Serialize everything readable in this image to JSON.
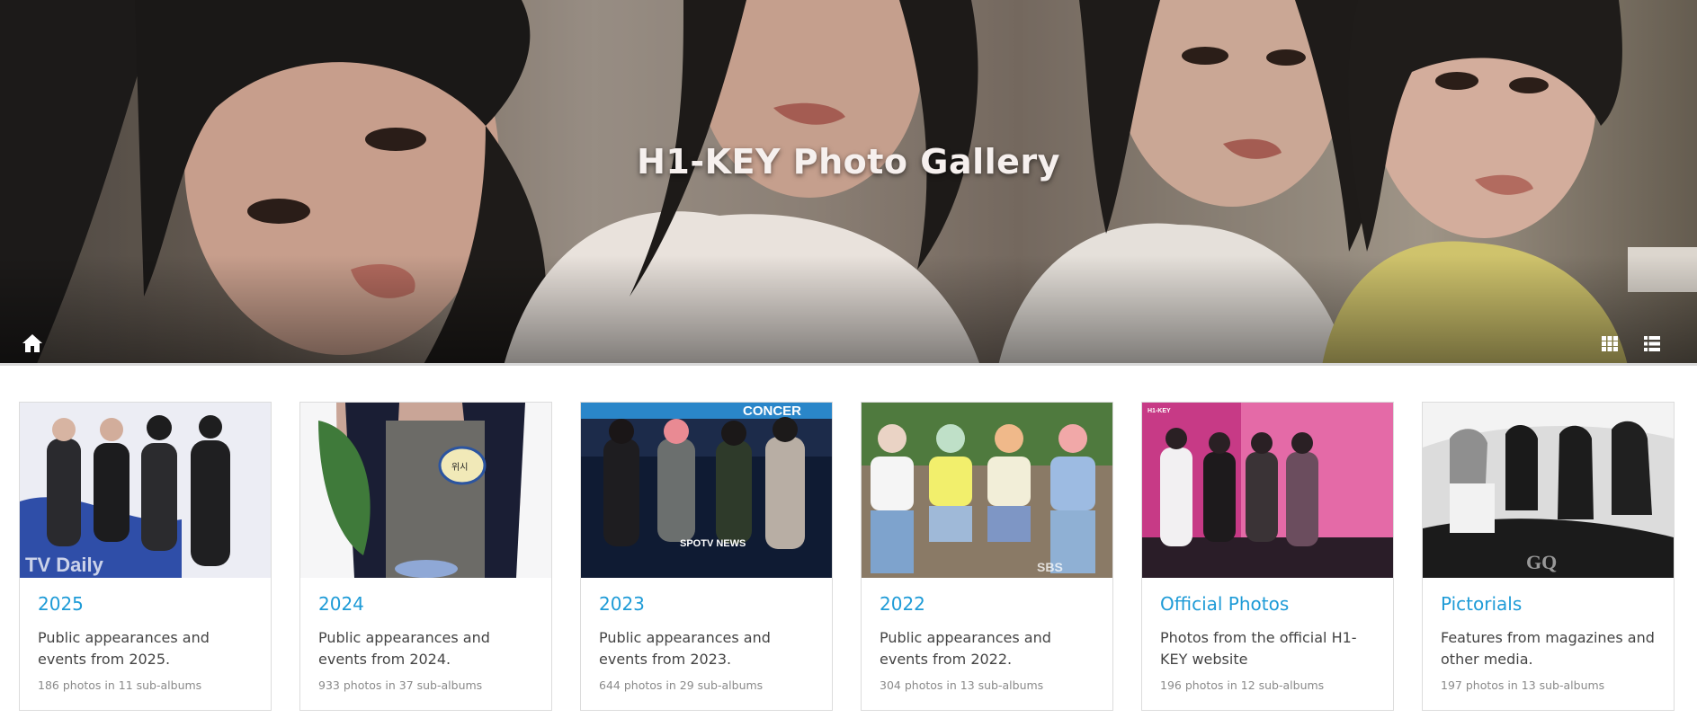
{
  "hero": {
    "title": "H1-KEY Photo Gallery",
    "icons": {
      "home": "home-icon",
      "grid_view": "grid-view-icon",
      "list_view": "list-view-icon"
    }
  },
  "albums": [
    {
      "title": "2025",
      "description": "Public appearances and events from 2025.",
      "meta": "186 photos in 11 sub-albums",
      "watermark": "TV Daily"
    },
    {
      "title": "2024",
      "description": "Public appearances and events from 2024.",
      "meta": "933 photos in 37 sub-albums",
      "watermark": ""
    },
    {
      "title": "2023",
      "description": "Public appearances and events from 2023.",
      "meta": "644 photos in 29 sub-albums",
      "watermark": "SPOTV NEWS"
    },
    {
      "title": "2022",
      "description": "Public appearances and events from 2022.",
      "meta": "304 photos in 13 sub-albums",
      "watermark": "SBS"
    },
    {
      "title": "Official Photos",
      "description": "Photos from the official H1-KEY website",
      "meta": "196 photos in 12 sub-albums",
      "watermark": "H1-KEY"
    },
    {
      "title": "Pictorials",
      "description": "Features from magazines and other media.",
      "meta": "197 photos in 13 sub-albums",
      "watermark": "GQ"
    }
  ],
  "colors": {
    "link": "#1e9bd7",
    "meta": "#8a8a8a",
    "border": "#dcdcdc"
  }
}
